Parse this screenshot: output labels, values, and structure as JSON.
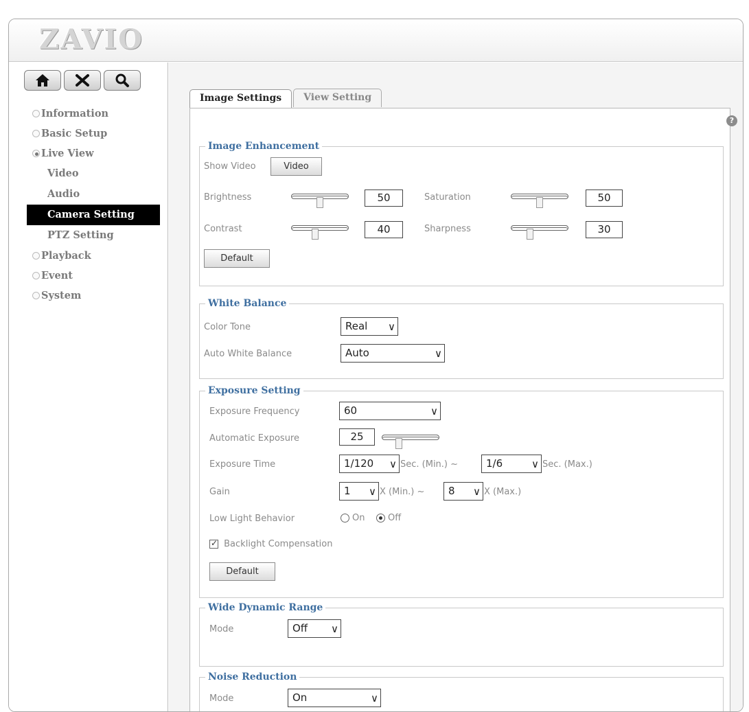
{
  "brand": {
    "logo_text": "ZAVIO"
  },
  "toolbar": {
    "home_icon": "home-icon",
    "tools_icon": "tools-icon",
    "search_icon": "search-icon"
  },
  "nav": {
    "items": [
      {
        "label": "Information",
        "selected": false
      },
      {
        "label": "Basic Setup",
        "selected": false
      },
      {
        "label": "Live View",
        "selected": true
      },
      {
        "label": "Playback",
        "selected": false
      },
      {
        "label": "Event",
        "selected": false
      },
      {
        "label": "System",
        "selected": false
      }
    ],
    "live_view_sub": [
      {
        "label": "Video"
      },
      {
        "label": "Audio"
      },
      {
        "label": "Camera Setting",
        "active": true
      },
      {
        "label": "PTZ Setting"
      }
    ]
  },
  "tabs": [
    {
      "label": "Image Settings",
      "active": true
    },
    {
      "label": "View Setting",
      "active": false
    }
  ],
  "image_enhancement": {
    "legend": "Image Enhancement",
    "show_video_label": "Show Video",
    "video_button": "Video",
    "brightness": {
      "label": "Brightness",
      "value": "50",
      "level": 0.5
    },
    "saturation": {
      "label": "Saturation",
      "value": "50",
      "level": 0.5
    },
    "contrast": {
      "label": "Contrast",
      "value": "40",
      "level": 0.4
    },
    "sharpness": {
      "label": "Sharpness",
      "value": "30",
      "level": 0.3
    },
    "default_button": "Default"
  },
  "white_balance": {
    "legend": "White Balance",
    "color_tone_label": "Color Tone",
    "color_tone_value": "Real",
    "awb_label": "Auto White Balance",
    "awb_value": "Auto"
  },
  "exposure": {
    "legend": "Exposure Setting",
    "frequency_label": "Exposure Frequency",
    "frequency_value": "60",
    "auto_label": "Automatic Exposure",
    "auto_value": "25",
    "auto_level": 0.25,
    "time_label": "Exposure Time",
    "time_min": "1/120",
    "sec_min_text": "Sec.  (Min.) ~",
    "time_max": "1/6",
    "sec_max_text": "Sec.  (Max.)",
    "gain_label": "Gain",
    "gain_min": "1",
    "gain_min_text": "X  (Min.) ~",
    "gain_max": "8",
    "gain_max_text": "X  (Max.)",
    "low_light_label": "Low Light Behavior",
    "low_light_on": "On",
    "low_light_off": "Off",
    "low_light_selected": "Off",
    "backlight_label": "Backlight Compensation",
    "backlight_checked": true,
    "default_button": "Default"
  },
  "wdr": {
    "legend": "Wide Dynamic Range",
    "mode_label": "Mode",
    "mode_value": "Off"
  },
  "noise": {
    "legend": "Noise Reduction",
    "mode_label": "Mode",
    "mode_value": "On"
  }
}
